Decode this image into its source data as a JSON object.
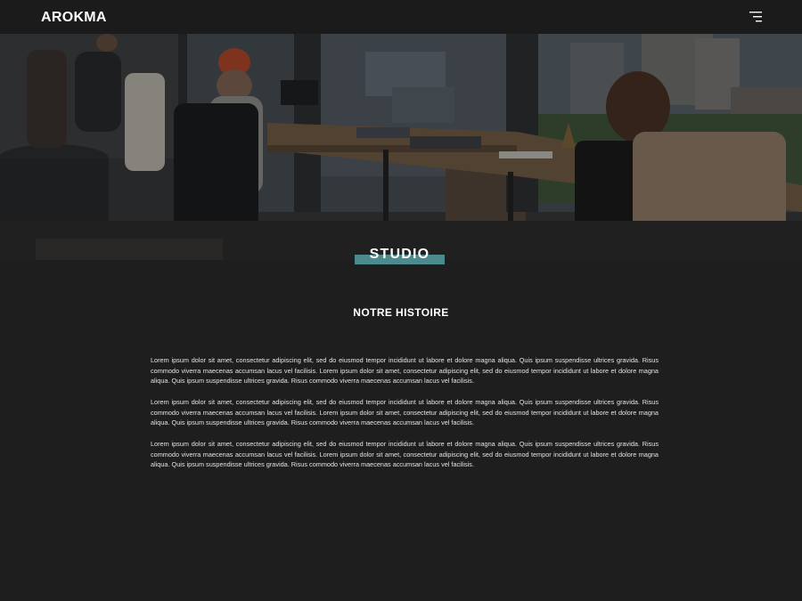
{
  "header": {
    "logo": "AROKMA",
    "menu_icon": "hamburger-menu-icon"
  },
  "hero": {
    "image": "office-photo",
    "section_label": "STUDIO",
    "accent_color": "#4d8a8d"
  },
  "story": {
    "heading": "NOTRE HISTOIRE",
    "paragraphs": [
      "Lorem ipsum dolor sit amet, consectetur adipiscing elit, sed do eiusmod tempor incididunt ut labore et dolore magna aliqua. Quis ipsum suspendisse ultrices gravida. Risus commodo viverra maecenas accumsan lacus vel facilisis. Lorem ipsum dolor sit amet, consectetur adipiscing elit, sed do eiusmod tempor incididunt ut labore et dolore magna aliqua. Quis ipsum suspendisse ultrices gravida. Risus commodo viverra maecenas accumsan lacus vel facilisis.",
      "Lorem ipsum dolor sit amet, consectetur adipiscing elit, sed do eiusmod tempor incididunt ut labore et dolore magna aliqua. Quis ipsum suspendisse ultrices gravida. Risus commodo viverra maecenas accumsan lacus vel facilisis. Lorem ipsum dolor sit amet, consectetur adipiscing elit, sed do eiusmod tempor incididunt ut labore et dolore magna aliqua. Quis ipsum suspendisse ultrices gravida. Risus commodo viverra maecenas accumsan lacus vel facilisis.",
      "Lorem ipsum dolor sit amet, consectetur adipiscing elit, sed do eiusmod tempor incididunt ut labore et dolore magna aliqua. Quis ipsum suspendisse ultrices gravida. Risus commodo viverra maecenas accumsan lacus vel facilisis. Lorem ipsum dolor sit amet, consectetur adipiscing elit, sed do eiusmod tempor incididunt ut labore et dolore magna aliqua. Quis ipsum suspendisse ultrices gravida. Risus commodo viverra maecenas accumsan lacus vel facilisis."
    ]
  },
  "colors": {
    "background": "#1e1e1e",
    "header_background": "#1b1b1b"
  }
}
